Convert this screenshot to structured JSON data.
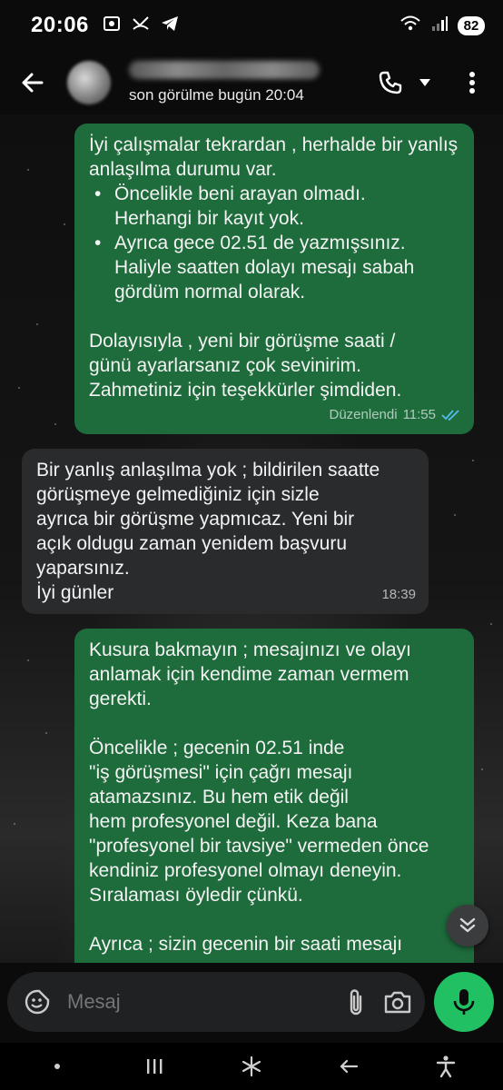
{
  "status_bar": {
    "time": "20:06",
    "battery": "82",
    "left_icons": [
      "screenshot-icon",
      "missed-call-icon",
      "telegram-icon"
    ],
    "right_icons": [
      "wifi-icon",
      "signal-icon"
    ]
  },
  "header": {
    "contact_status": "son görülme bugün 20:04",
    "actions": [
      "phone-icon",
      "dropdown-icon",
      "more-vert-icon"
    ]
  },
  "messages": [
    {
      "direction": "outgoing",
      "intro": "İyi çalışmalar tekrardan , herhalde bir yanlış anlaşılma durumu var.",
      "bullet_1": "Öncelikle beni arayan olmadı.\nHerhangi bir kayıt yok.",
      "bullet_2": "Ayrıca gece 02.51 de yazmışsınız.\nHaliyle saatten dolayı mesajı sabah\ngördüm normal olarak.",
      "outro": "Dolayısıyla , yeni bir görüşme saati /\ngünü ayarlarsanız çok sevinirim.\nZahmetiniz için teşekkürler şimdiden.",
      "edited_label": "Düzenlendi",
      "time": "11:55",
      "read": true
    },
    {
      "direction": "incoming",
      "text": "Bir yanlış anlaşılma yok ; bildirilen saatte\ngörüşmeye gelmediğiniz için sizle\nayrıca bir görüşme yapmıcaz.  Yeni bir\naçık oldugu zaman yenidem başvuru\nyaparsınız.\nİyi günler",
      "time": "18:39"
    },
    {
      "direction": "outgoing",
      "para_1": "Kusura bakmayın ; mesajınızı ve olayı\nanlamak için kendime zaman vermem\ngerekti.",
      "para_2": "Öncelikle ; gecenin 02.51 inde\n\"iş görüşmesi\" için çağrı mesajı\natamazsınız. Bu hem etik değil\nhem profesyonel değil. Keza bana\n\"profesyonel bir tavsiye\" vermeden önce\nkendiniz profesyonel olmayı deneyin.\nSıralaması öyledir çünkü.",
      "para_3": "Ayrıca ; sizin gecenin bir saati mesajı"
    }
  ],
  "composer": {
    "placeholder": "Mesaj"
  },
  "colors": {
    "outgoing_bubble": "#1e6b3c",
    "incoming_bubble": "#2a2b2d",
    "mic_button": "#21c063",
    "read_ticks": "#53bdeb"
  }
}
